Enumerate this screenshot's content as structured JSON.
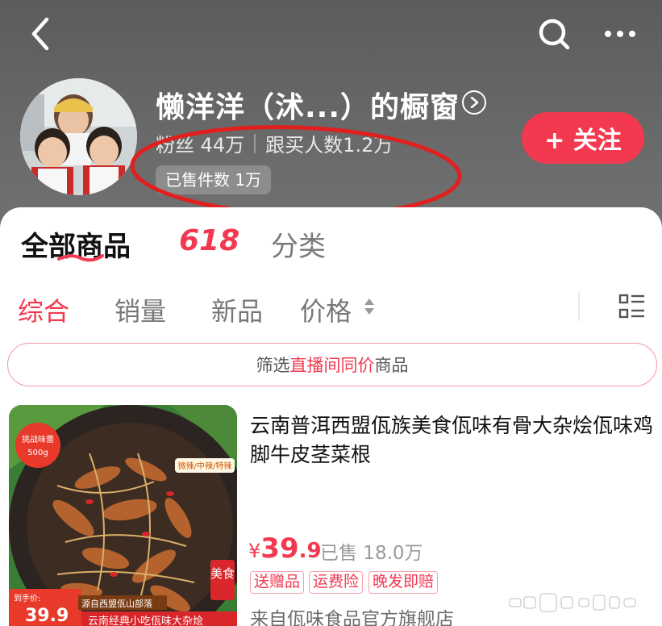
{
  "header": {
    "store_title": "懒洋洋（沭...）的橱窗",
    "fans": "粉丝 44万",
    "followers_buy": "跟买人数1.2万",
    "sold_total": "已售件数 1万",
    "follow_label": "+ 关注"
  },
  "tabs": {
    "all_goods": "全部商品",
    "promo_618": "618",
    "category": "分类"
  },
  "sort": {
    "composite": "综合",
    "sales": "销量",
    "new": "新品",
    "price": "价格"
  },
  "filter": {
    "prefix": "筛选",
    "highlight": "直播间同价",
    "suffix": "商品"
  },
  "product": {
    "name": "云南普洱西盟佤族美食佤味有骨大杂烩佤味鸡脚牛皮茎菜根",
    "price_currency": "¥",
    "price_int": "39",
    "price_dec": ".9",
    "sold": "已售 18.0万",
    "tags": [
      "送赠品",
      "运费险",
      "晚发即赔"
    ],
    "shop_from": "来自佤味食品官方旗舰店",
    "image_text": {
      "challenge_label": "挑战味蕾",
      "weight": "500g",
      "spice_levels": "微辣/中辣/特辣",
      "food_badge": "美食",
      "hand_price_label": "到手价:",
      "hand_price": "39.9",
      "origin": "源自西盟佤山部落",
      "bottom_caption": "云南经典小吃佤味大杂烩"
    }
  },
  "icons": {
    "back": "back-chevron-icon",
    "search": "search-icon",
    "more": "more-dots-icon",
    "title_arrow": "circle-chevron-right-icon",
    "price_sort": "sort-updown-icon",
    "list_view": "list-view-icon"
  },
  "colors": {
    "accent": "#f3394f",
    "header_bg": "#666666",
    "annotation": "#e0201f"
  }
}
